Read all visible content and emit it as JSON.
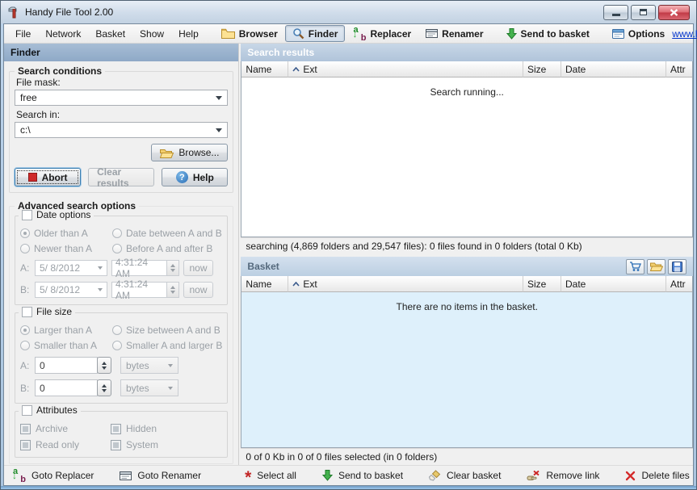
{
  "window": {
    "title": "Handy File Tool 2.00"
  },
  "menu": {
    "items": [
      "File",
      "Network",
      "Basket",
      "Show",
      "Help"
    ]
  },
  "toolbar": {
    "browser": "Browser",
    "finder": "Finder",
    "replacer": "Replacer",
    "renamer": "Renamer",
    "send_to_basket": "Send to basket",
    "options": "Options",
    "website": "www.handyfiletool.com"
  },
  "finder": {
    "panel_title": "Finder",
    "conditions": {
      "title": "Search conditions",
      "file_mask_label": "File mask:",
      "file_mask": "free",
      "search_in_label": "Search in:",
      "search_in": "c:\\",
      "browse": "Browse...",
      "abort": "Abort",
      "clear_results": "Clear results",
      "help": "Help"
    },
    "advanced": {
      "title": "Advanced search options",
      "date": {
        "title": "Date options",
        "older": "Older than A",
        "newer": "Newer than A",
        "between": "Date between A and B",
        "before_after": "Before A and after B",
        "a_label": "A:",
        "b_label": "B:",
        "a_date": "5/ 8/2012",
        "a_time": "4:31:24 AM",
        "b_date": "5/ 8/2012",
        "b_time": "4:31:24 AM",
        "now": "now"
      },
      "size": {
        "title": "File size",
        "larger": "Larger than A",
        "smaller": "Smaller than A",
        "between": "Size between A and B",
        "smaller_larger": "Smaller A and larger B",
        "a_label": "A:",
        "b_label": "B:",
        "a_value": "0",
        "b_value": "0",
        "a_unit": "bytes",
        "b_unit": "bytes"
      },
      "attributes": {
        "title": "Attributes",
        "archive": "Archive",
        "hidden": "Hidden",
        "read_only": "Read only",
        "system": "System"
      }
    }
  },
  "search_results": {
    "panel_title": "Search results",
    "columns": [
      "Name",
      "Ext",
      "Size",
      "Date",
      "Attr"
    ],
    "message": "Search running...",
    "status": "searching (4,869 folders and 29,547 files): 0 files found in 0 folders (total 0 Kb)"
  },
  "basket": {
    "panel_title": "Basket",
    "columns": [
      "Name",
      "Ext",
      "Size",
      "Date",
      "Attr"
    ],
    "message": "There are no items in the basket.",
    "status": "0 of 0 Kb in 0 of 0 files selected (in 0 folders)"
  },
  "bottom": {
    "goto_replacer": "Goto Replacer",
    "goto_renamer": "Goto Renamer",
    "select_all": "Select all",
    "send_to_basket": "Send to basket",
    "clear_basket": "Clear basket",
    "remove_link": "Remove link",
    "delete_files": "Delete files"
  },
  "colors": {
    "accent_blue": "#2a6db5",
    "close_red": "#c13a46",
    "link_blue": "#0033cc",
    "disabled_text": "#9aa0a6",
    "basket_body_bg": "#def0fb",
    "active_header": "#8ea9c7",
    "inactive_header": "#b0c4da"
  }
}
